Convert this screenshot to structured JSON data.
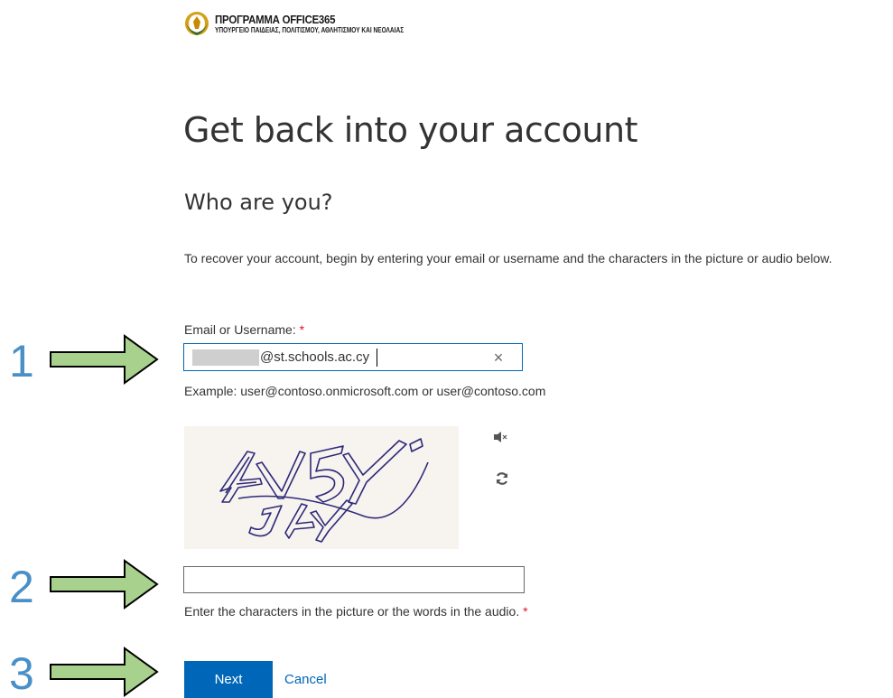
{
  "brand": {
    "title": "ΠΡΟΓΡΑΜΜΑ OFFICE365",
    "subtitle": "ΥΠΟΥΡΓΕΙΟ ΠΑΙΔΕΙΑΣ, ΠΟΛΙΤΙΣΜΟΥ, ΑΘΛΗΤΙΣΜΟΥ ΚΑΙ ΝΕΟΛΑΙΑΣ"
  },
  "page": {
    "heading": "Get back into your account",
    "subheading": "Who are you?",
    "description": "To recover your account, begin by entering your email or username and the characters in the picture or audio below."
  },
  "email": {
    "label": "Email or Username:",
    "required_mark": "*",
    "value": "@st.schools.ac.cy",
    "clear_glyph": "×",
    "example": "Example: user@contoso.onmicrosoft.com or user@contoso.com"
  },
  "captcha": {
    "text": "4V5Y J4Y",
    "hint": "Enter the characters in the picture or the words in the audio.",
    "required_mark": "*",
    "value": ""
  },
  "actions": {
    "next_label": "Next",
    "cancel_label": "Cancel"
  },
  "annotations": {
    "steps": [
      "1",
      "2",
      "3"
    ],
    "arrow_fill": "#a9d18e",
    "arrow_stroke": "#000000",
    "number_color": "#4a90c8"
  },
  "colors": {
    "accent": "#0067b8",
    "required": "#e81123"
  }
}
